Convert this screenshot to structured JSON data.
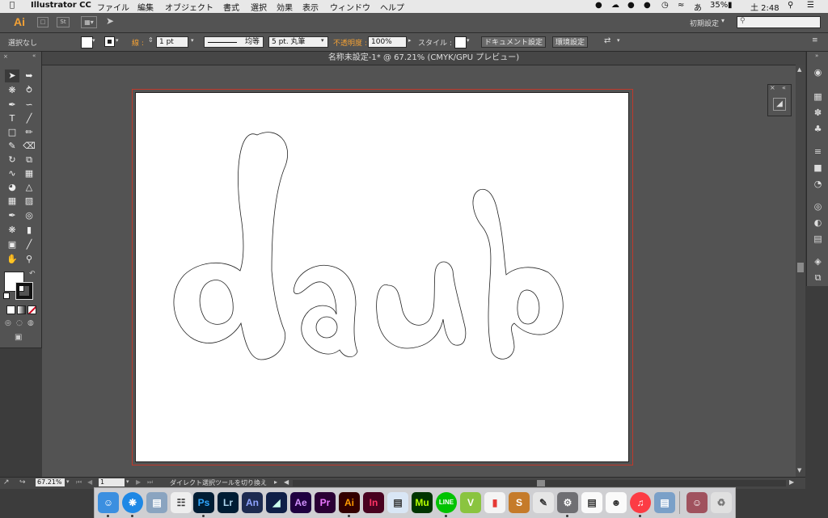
{
  "menubar": {
    "app_name": "Illustrator CC",
    "items": [
      "ファイル",
      "編集",
      "オブジェクト",
      "書式",
      "選択",
      "効果",
      "表示",
      "ウィンドウ",
      "ヘルプ"
    ],
    "battery": "35%",
    "clock": "土 2:48",
    "ime": "あ"
  },
  "appbar": {
    "logo": "Ai",
    "st_label": "St",
    "workspace": "初期設定"
  },
  "control": {
    "selection_label": "選択なし",
    "stroke_label": "線 :",
    "stroke_weight": "1 pt",
    "stroke_style": "均等",
    "brush": "5 pt. 丸筆",
    "opacity_label": "不透明度 :",
    "opacity_value": "100%",
    "style_label": "スタイル :",
    "doc_settings": "ドキュメント設定",
    "env_settings": "環境設定"
  },
  "document": {
    "title": "名称未設定-1* @ 67.21% (CMYK/GPU プレビュー)"
  },
  "status": {
    "zoom": "67.21%",
    "artboard": "1",
    "tool_hint": "ダイレクト選択ツールを切り換え"
  },
  "dock": {
    "apps": [
      "Ps",
      "Lr",
      "An",
      "Ae",
      "Pr",
      "Ai",
      "In",
      "Mu",
      "LINE"
    ]
  },
  "colors": {
    "accent": "#f4a235",
    "artboard_border": "#c0392b",
    "panel": "#535353"
  }
}
